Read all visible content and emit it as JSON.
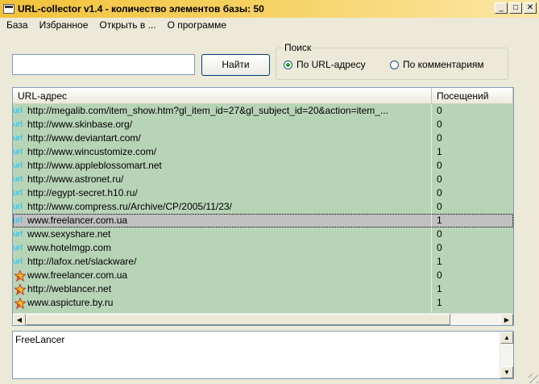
{
  "window": {
    "title": "URL-collector v1.4 - количество элементов базы: 50",
    "buttons": {
      "minimize": "_",
      "maximize": "□",
      "close": "✕"
    }
  },
  "menu": [
    "База",
    "Избранное",
    "Открыть в ...",
    "О программе"
  ],
  "search": {
    "value": "",
    "button_label": "Найти",
    "group_label": "Поиск",
    "options": [
      {
        "label": "По URL-адресу",
        "selected": true
      },
      {
        "label": "По комментариям",
        "selected": false
      }
    ]
  },
  "table": {
    "columns": [
      "URL-адрес",
      "Посещений"
    ],
    "icon_text": "url",
    "rows": [
      {
        "icon": "url",
        "url": "http://megalib.com/item_show.htm?gl_item_id=27&gl_subject_id=20&action=item_...",
        "visits": "0",
        "selected": false
      },
      {
        "icon": "url",
        "url": "http://www.skinbase.org/",
        "visits": "0",
        "selected": false
      },
      {
        "icon": "url",
        "url": "http://www.deviantart.com/",
        "visits": "0",
        "selected": false
      },
      {
        "icon": "url",
        "url": "http://www.wincustomize.com/",
        "visits": "1",
        "selected": false
      },
      {
        "icon": "url",
        "url": "http://www.appleblossomart.net",
        "visits": "0",
        "selected": false
      },
      {
        "icon": "url",
        "url": "http://www.astronet.ru/",
        "visits": "0",
        "selected": false
      },
      {
        "icon": "url",
        "url": "http://egypt-secret.h10.ru/",
        "visits": "0",
        "selected": false
      },
      {
        "icon": "url",
        "url": "http://www.compress.ru/Archive/CP/2005/11/23/",
        "visits": "0",
        "selected": false
      },
      {
        "icon": "url",
        "url": "www.freelancer.com.ua",
        "visits": "1",
        "selected": true
      },
      {
        "icon": "url",
        "url": "www.sexyshare.net",
        "visits": "0",
        "selected": false
      },
      {
        "icon": "url",
        "url": "www.hotelmgp.com",
        "visits": "0",
        "selected": false
      },
      {
        "icon": "url",
        "url": "http://lafox.net/slackware/",
        "visits": "1",
        "selected": false
      },
      {
        "icon": "star",
        "url": "www.freelancer.com.ua",
        "visits": "0",
        "selected": false
      },
      {
        "icon": "star",
        "url": "http://weblancer.net",
        "visits": "1",
        "selected": false
      },
      {
        "icon": "star",
        "url": "www.aspicture.by.ru",
        "visits": "1",
        "selected": false
      }
    ]
  },
  "comment": {
    "text": "FreeLancer"
  },
  "colors": {
    "row_bg": "#B7D4B7",
    "selected_row_bg": "#C0C0C0",
    "url_icon": "#3DC8F0",
    "titlebar": "#F2C23A"
  }
}
